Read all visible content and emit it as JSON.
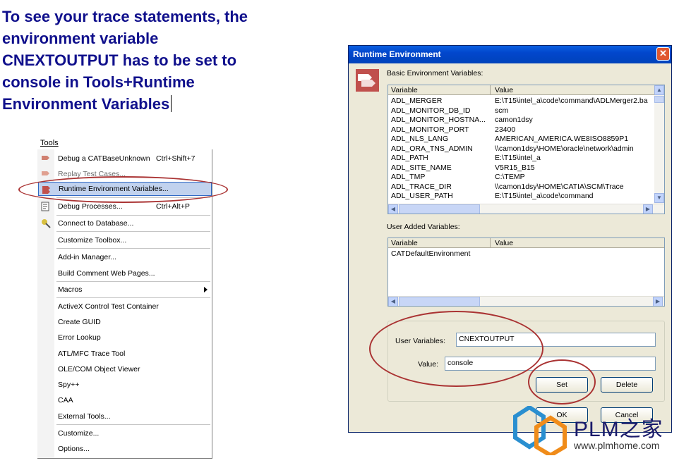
{
  "heading": {
    "lines": [
      "To see your trace statements, the",
      "environment variable",
      "CNEXTOUTPUT has to be set to",
      "console in Tools+Runtime",
      "Environment Variables"
    ]
  },
  "tools_menu": {
    "title": "Tools",
    "items": [
      {
        "label": "Debug a CATBaseUnknown",
        "shortcut": "Ctrl+Shift+7",
        "icon": "debug-arrow-icon"
      },
      {
        "label": "Replay Test Cases...",
        "shortcut": "",
        "icon": "replay-arrow-icon"
      },
      {
        "label": "Runtime Environment Variables...",
        "shortcut": "",
        "icon": "runtime-env-icon"
      },
      {
        "label": "Debug Processes...",
        "shortcut": "Ctrl+Alt+P",
        "icon": "debug-processes-icon"
      },
      {
        "label": "Connect to Database...",
        "shortcut": "",
        "icon": "database-connect-icon"
      },
      {
        "label": "Customize Toolbox...",
        "shortcut": ""
      },
      {
        "label": "Add-in Manager...",
        "shortcut": ""
      },
      {
        "label": "Build Comment Web Pages...",
        "shortcut": ""
      },
      {
        "label": "Macros",
        "shortcut": ""
      },
      {
        "label": "ActiveX Control Test Container",
        "shortcut": ""
      },
      {
        "label": "Create GUID",
        "shortcut": ""
      },
      {
        "label": "Error Lookup",
        "shortcut": ""
      },
      {
        "label": "ATL/MFC Trace Tool",
        "shortcut": ""
      },
      {
        "label": "OLE/COM Object Viewer",
        "shortcut": ""
      },
      {
        "label": "Spy++",
        "shortcut": ""
      },
      {
        "label": "CAA",
        "shortcut": ""
      },
      {
        "label": "External Tools...",
        "shortcut": ""
      },
      {
        "label": "Customize...",
        "shortcut": ""
      },
      {
        "label": "Options...",
        "shortcut": ""
      }
    ]
  },
  "dialog": {
    "title": "Runtime Environment",
    "close_glyph": "✕",
    "basic_label": "Basic Environment Variables:",
    "columns": {
      "variable": "Variable",
      "value": "Value"
    },
    "basic_rows": [
      {
        "variable": "ADL_MERGER",
        "value": "E:\\T15\\intel_a\\code\\command\\ADLMerger2.ba"
      },
      {
        "variable": "ADL_MONITOR_DB_ID",
        "value": "scm"
      },
      {
        "variable": "ADL_MONITOR_HOSTNA...",
        "value": "camon1dsy"
      },
      {
        "variable": "ADL_MONITOR_PORT",
        "value": "23400"
      },
      {
        "variable": "ADL_NLS_LANG",
        "value": "AMERICAN_AMERICA.WE8ISO8859P1"
      },
      {
        "variable": "ADL_ORA_TNS_ADMIN",
        "value": "\\\\camon1dsy\\HOME\\oracle\\network\\admin"
      },
      {
        "variable": "ADL_PATH",
        "value": "E:\\T15\\intel_a"
      },
      {
        "variable": "ADL_SITE_NAME",
        "value": "V5R15_B15"
      },
      {
        "variable": "ADL_TMP",
        "value": "C:\\TEMP"
      },
      {
        "variable": "ADL_TRACE_DIR",
        "value": "\\\\camon1dsy\\HOME\\CATIA\\SCM\\Trace"
      },
      {
        "variable": "ADL_USER_PATH",
        "value": "E:\\T15\\intel_a\\code\\command"
      }
    ],
    "user_added_label": "User Added Variables:",
    "user_rows": [
      {
        "variable": "CATDefaultEnvironment",
        "value": ""
      }
    ],
    "user_variables_label": "User Variables:",
    "user_variables_value": "CNEXTOUTPUT",
    "value_label": "Value:",
    "value_value": "console",
    "set_label": "Set",
    "delete_label": "Delete",
    "ok_label": "OK",
    "cancel_label": "Cancel"
  },
  "watermark": {
    "text": "PLM之家",
    "url": "www.plmhome.com"
  },
  "colors": {
    "heading": "#10108c",
    "annotation_ellipse": "#aa3333",
    "titlebar": "#0246cc",
    "menu_highlight": "#c1d2ee"
  }
}
